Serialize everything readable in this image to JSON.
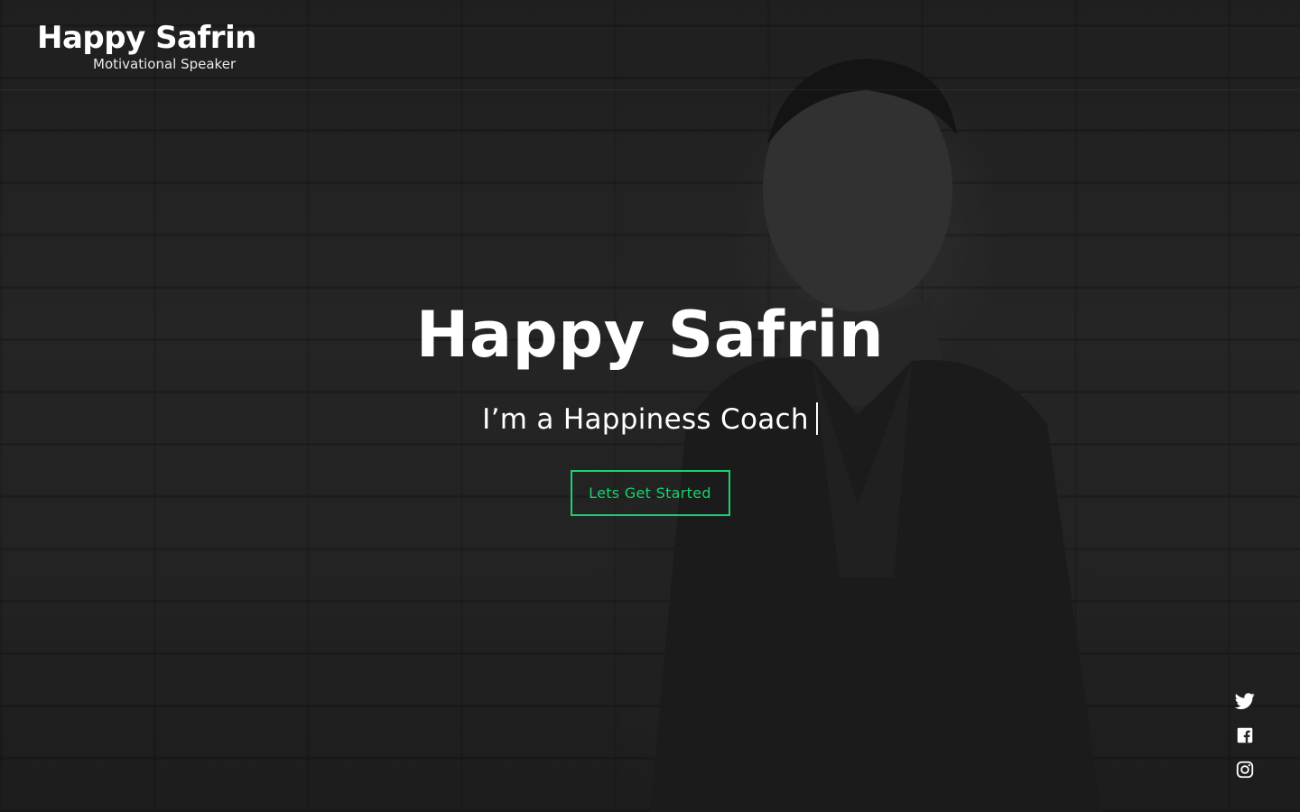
{
  "header": {
    "logo_name": "Happy Safrin",
    "logo_tagline": "Motivational Speaker"
  },
  "hero": {
    "title": "Happy Safrin",
    "subtitle": "I’m a Happiness Coach",
    "cta_label": "Lets Get Started"
  },
  "social": [
    {
      "icon": "twitter-icon"
    },
    {
      "icon": "facebook-icon"
    },
    {
      "icon": "instagram-icon"
    }
  ],
  "colors": {
    "accent": "#18d26e",
    "text": "#ffffff"
  }
}
